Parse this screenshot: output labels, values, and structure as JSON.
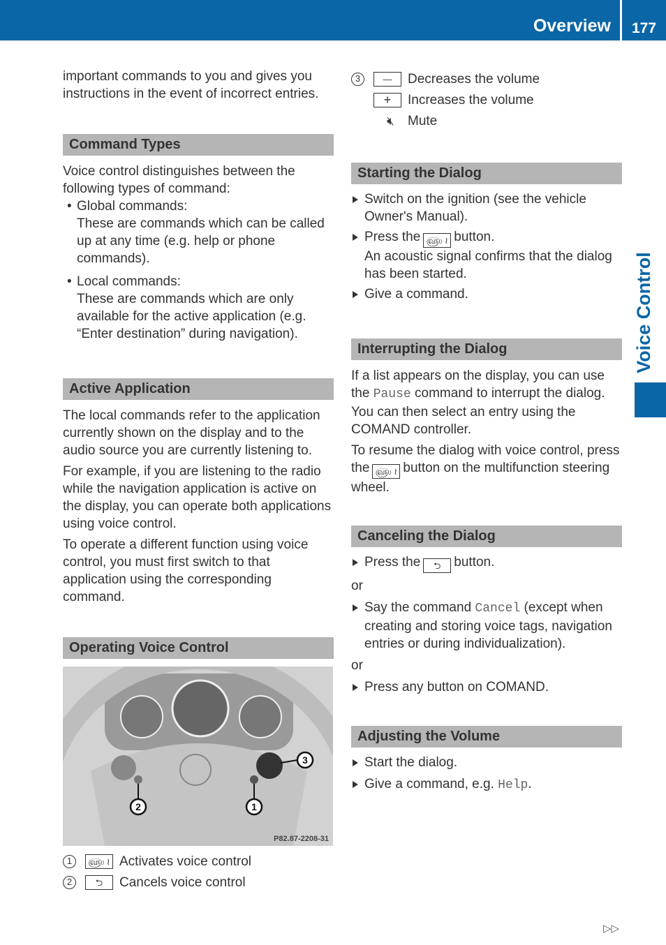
{
  "header": {
    "title": "Overview",
    "page_number": "177"
  },
  "side_tab": "Voice Control",
  "colors": {
    "brand_blue": "#0a66a6",
    "section_header_bg": "#b5b5b5"
  },
  "left": {
    "intro": "important commands to you and gives you instructions in the event of incorrect entries.",
    "command_types": {
      "title": "Command Types",
      "intro": "Voice control distinguishes between the following types of command:",
      "items": [
        {
          "label": "Global commands:",
          "text": "These are commands which can be called up at any time (e.g. help or phone commands)."
        },
        {
          "label": "Local commands:",
          "text": "These are commands which are only available for the active application (e.g. “Enter destination” during navigation)."
        }
      ]
    },
    "active_application": {
      "title": "Active Application",
      "paragraphs": [
        "The local commands refer to the application currently shown on the display and to the audio source you are currently listening to.",
        "For example, if you are listening to the radio while the navigation application is active on the display, you can operate both applications using voice control.",
        "To operate a different function using voice control, you must first switch to that application using the corresponding command."
      ]
    },
    "operating": {
      "title": "Operating Voice Control",
      "image_code": "P82.87-2208-31",
      "legend": [
        {
          "num": "1",
          "icon": "voice-button-icon",
          "text": "Activates voice control"
        },
        {
          "num": "2",
          "icon": "back-button-icon",
          "text": "Cancels voice control"
        }
      ]
    }
  },
  "right": {
    "legend3": {
      "num": "3",
      "items": [
        {
          "icon": "minus-button-icon",
          "text": "Decreases the volume"
        },
        {
          "icon": "plus-button-icon",
          "text": "Increases the volume"
        },
        {
          "icon": "mute-icon",
          "text": "Mute"
        }
      ]
    },
    "starting": {
      "title": "Starting the Dialog",
      "step1": "Switch on the ignition (see the vehicle Owner's Manual).",
      "step2_pre": "Press the",
      "step2_post": "button.",
      "step2_note": "An acoustic signal confirms that the dialog has been started.",
      "step3": "Give a command."
    },
    "interrupting": {
      "title": "Interrupting the Dialog",
      "p1_pre": "If a list appears on the display, you can use the",
      "p1_code": "Pause",
      "p1_post": "command to interrupt the dialog. You can then select an entry using the COMAND controller.",
      "p2_pre": "To resume the dialog with voice control, press the",
      "p2_post": "button on the multifunction steering wheel."
    },
    "canceling": {
      "title": "Canceling the Dialog",
      "step1_pre": "Press the",
      "step1_post": "button.",
      "or": "or",
      "step2_pre": "Say the command",
      "step2_code": "Cancel",
      "step2_post": "(except when creating and storing voice tags, navigation entries or during individualization).",
      "step3": "Press any button on COMAND."
    },
    "adjusting": {
      "title": "Adjusting the Volume",
      "step1": "Start the dialog.",
      "step2_pre": "Give a command, e.g.",
      "step2_code": "Help",
      "step2_post": "."
    }
  },
  "footer": {
    "next_symbol": "▷▷"
  }
}
